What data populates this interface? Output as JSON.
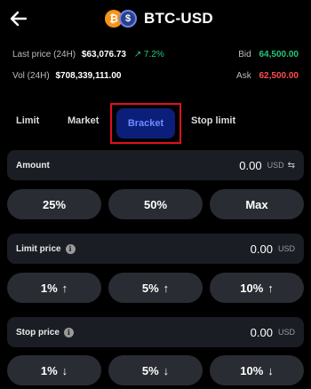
{
  "header": {
    "title": "BTC-USD",
    "base_coin_glyph": "₿",
    "quote_coin_glyph": "$"
  },
  "stats": {
    "last_price_label": "Last price (24H)",
    "last_price_value": "$63,076.73",
    "change": "↗ 7.2%",
    "volume_label": "Vol (24H)",
    "volume_value": "$708,339,111.00",
    "bid_label": "Bid",
    "bid_value": "64,500.00",
    "ask_label": "Ask",
    "ask_value": "62,500.00"
  },
  "tabs": [
    {
      "label": "Limit"
    },
    {
      "label": "Market"
    },
    {
      "label": "Bracket"
    },
    {
      "label": "Stop limit"
    }
  ],
  "amount": {
    "label": "Amount",
    "value": "0.00",
    "currency": "USD",
    "swap_icon": "⇆"
  },
  "amount_presets": [
    "25%",
    "50%",
    "Max"
  ],
  "limit_price": {
    "label": "Limit price",
    "value": "0.00",
    "currency": "USD"
  },
  "limit_presets": [
    {
      "label": "1%",
      "arrow": "↑"
    },
    {
      "label": "5%",
      "arrow": "↑"
    },
    {
      "label": "10%",
      "arrow": "↑"
    }
  ],
  "stop_price": {
    "label": "Stop price",
    "value": "0.00",
    "currency": "USD"
  },
  "stop_presets": [
    {
      "label": "1%",
      "arrow": "↓"
    },
    {
      "label": "5%",
      "arrow": "↓"
    },
    {
      "label": "10%",
      "arrow": "↓"
    }
  ],
  "colors": {
    "bid": "#21c87a",
    "ask": "#ff4d4d",
    "active_tab_bg": "#0b1f7a",
    "highlight": "#e0101e"
  }
}
